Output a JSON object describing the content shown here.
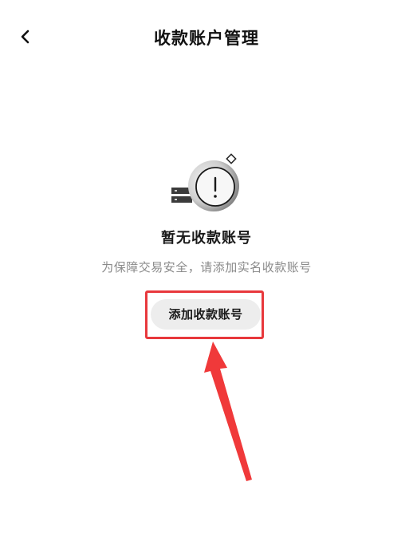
{
  "header": {
    "back_icon": "chevron-left-icon",
    "title": "收款账户管理"
  },
  "empty_state": {
    "illustration": "alert-coin-icon",
    "title": "暂无收款账号",
    "subtitle": "为保障交易安全，请添加实名收款账号",
    "add_button_label": "添加收款账号"
  },
  "annotation": {
    "color": "#e8383c",
    "shape": "arrow-pointing-up-to-highlight-box"
  }
}
